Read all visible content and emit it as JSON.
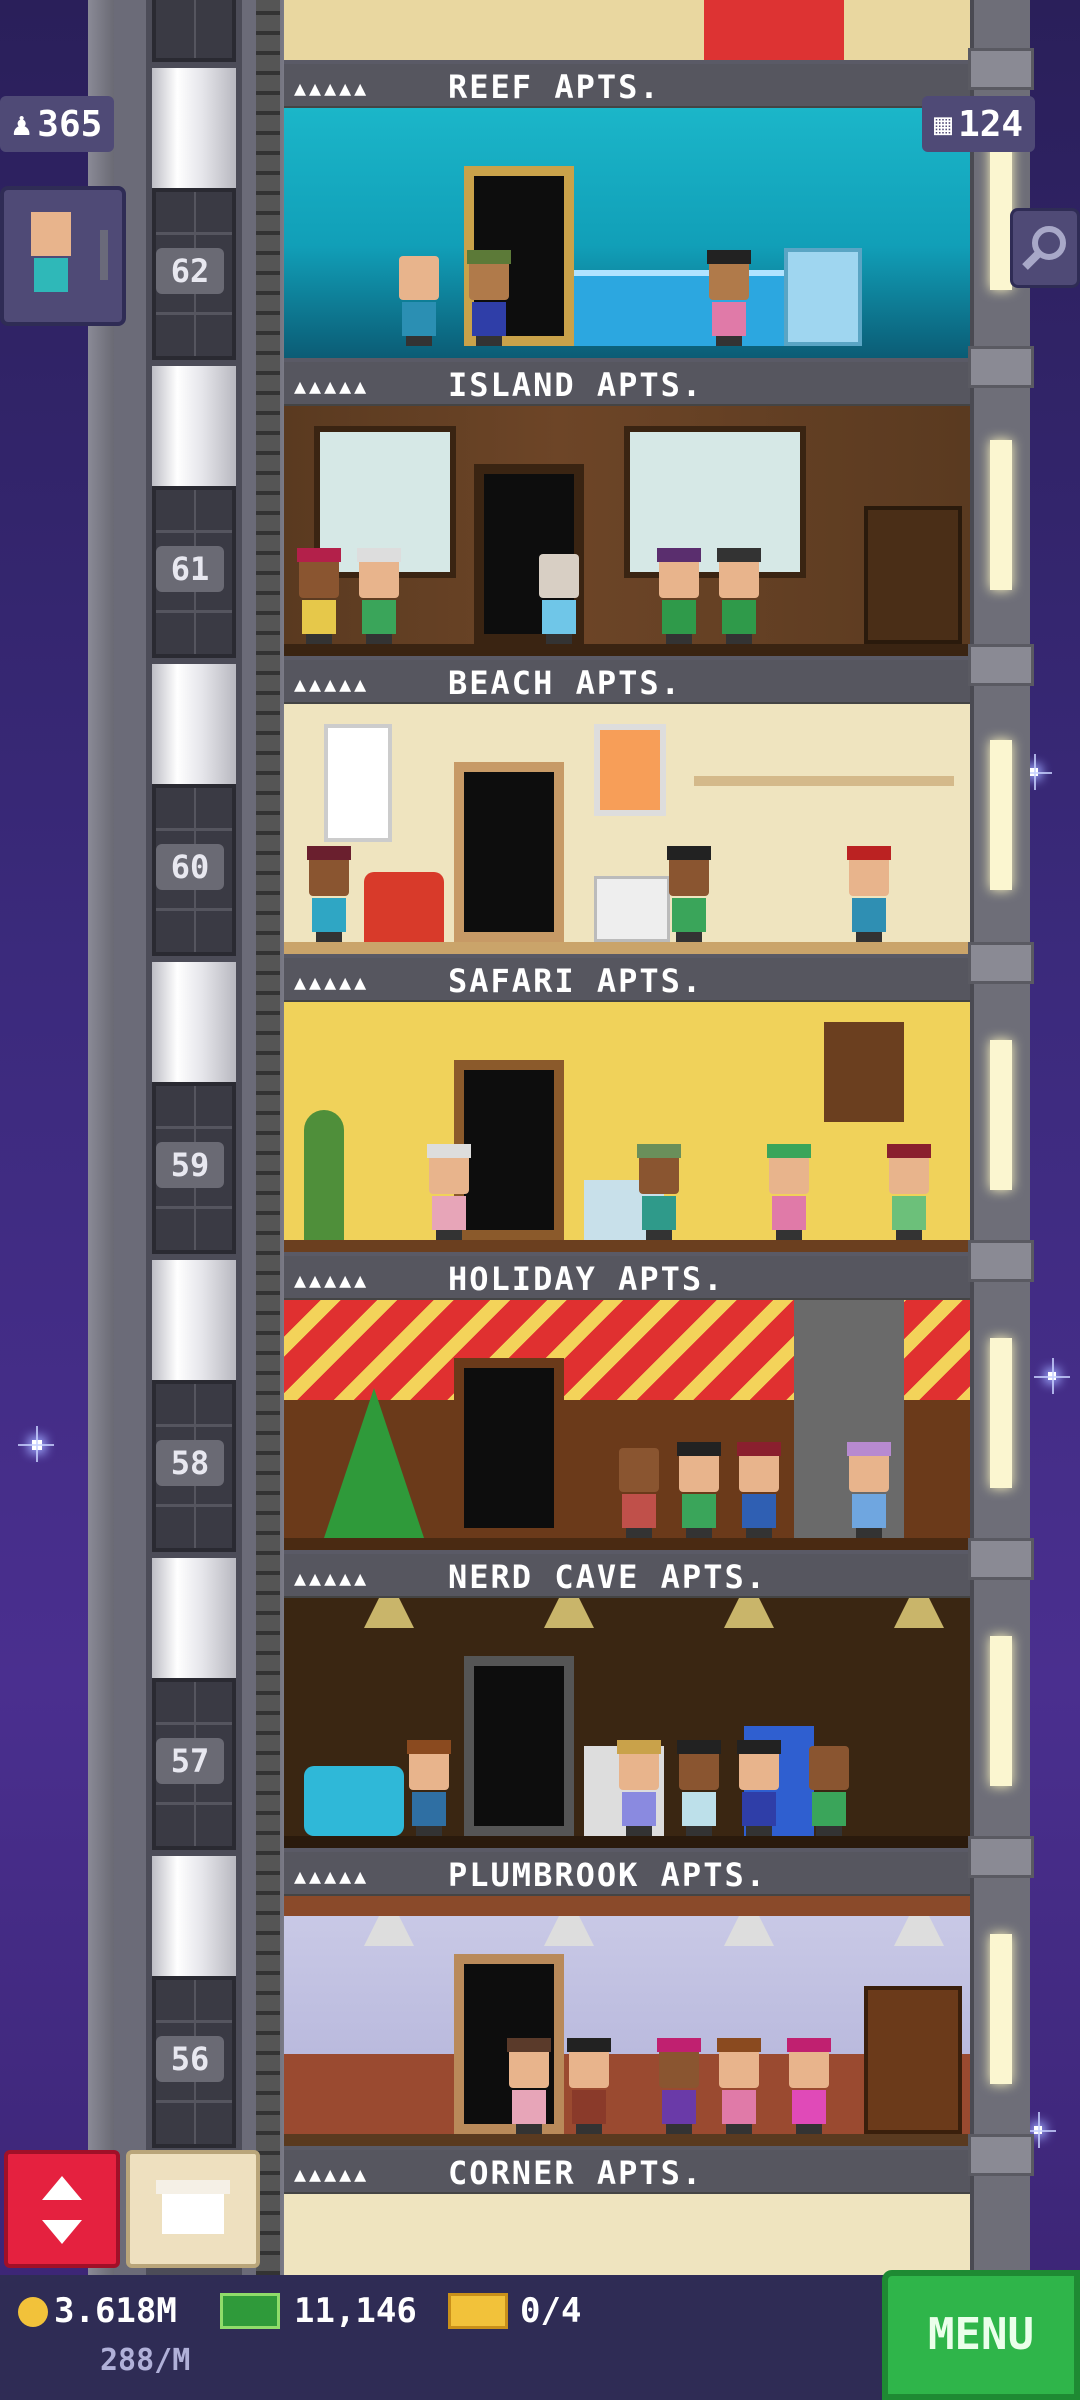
{
  "hud": {
    "population": "365",
    "floors": "124"
  },
  "floors": [
    {
      "number": "62",
      "name": "REEF APTS."
    },
    {
      "number": "61",
      "name": "ISLAND APTS."
    },
    {
      "number": "60",
      "name": "BEACH APTS."
    },
    {
      "number": "59",
      "name": "SAFARI APTS."
    },
    {
      "number": "58",
      "name": "HOLIDAY APTS."
    },
    {
      "number": "57",
      "name": "NERD CAVE APTS."
    },
    {
      "number": "56",
      "name": "PLUMBROOK APTS."
    }
  ],
  "bottom_label": "CORNER APTS.",
  "rating_stars": "▲▲▲▲▲",
  "status_bar": {
    "coins": "3.618M",
    "coin_rate": "288/M",
    "bux": "11,146",
    "tickets": "0/4",
    "menu_label": "MENU"
  },
  "colors": {
    "menu_green": "#2fb54a",
    "elevator_red": "#e5213f",
    "hud_purple": "#4f4a76"
  }
}
